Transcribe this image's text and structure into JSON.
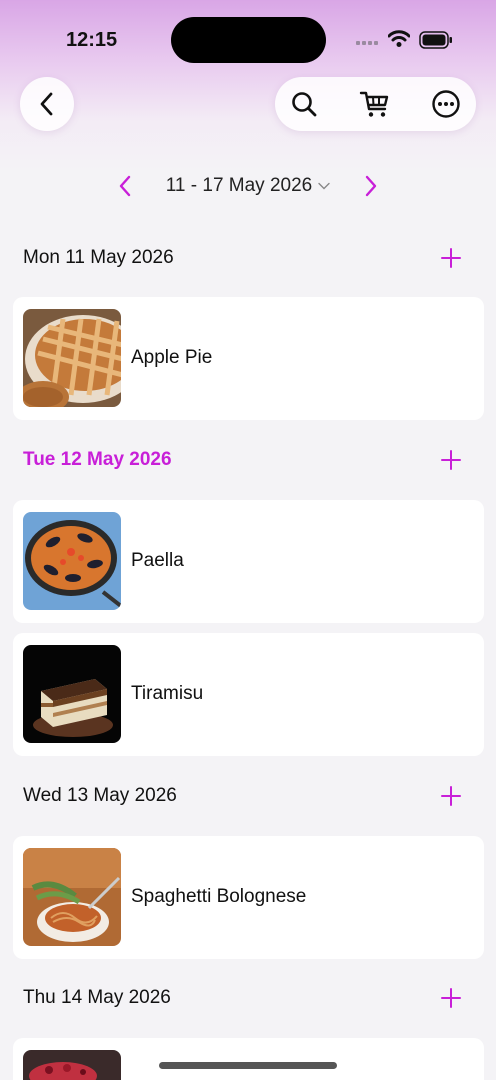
{
  "status_bar": {
    "time": "12:15"
  },
  "colors": {
    "accent": "#c81fd8"
  },
  "nav": {
    "back_icon": "chevron-left-icon",
    "actions": [
      "search-icon",
      "cart-icon",
      "more-icon"
    ]
  },
  "week": {
    "label": "11 - 17 May 2026"
  },
  "days": [
    {
      "title": "Mon 11 May 2026",
      "today": false,
      "meals": [
        "Apple Pie"
      ]
    },
    {
      "title": "Tue 12 May 2026",
      "today": true,
      "meals": [
        "Paella",
        "Tiramisu"
      ]
    },
    {
      "title": "Wed 13 May 2026",
      "today": false,
      "meals": [
        "Spaghetti Bolognese"
      ]
    },
    {
      "title": "Thu 14 May 2026",
      "today": false,
      "meals": []
    }
  ]
}
